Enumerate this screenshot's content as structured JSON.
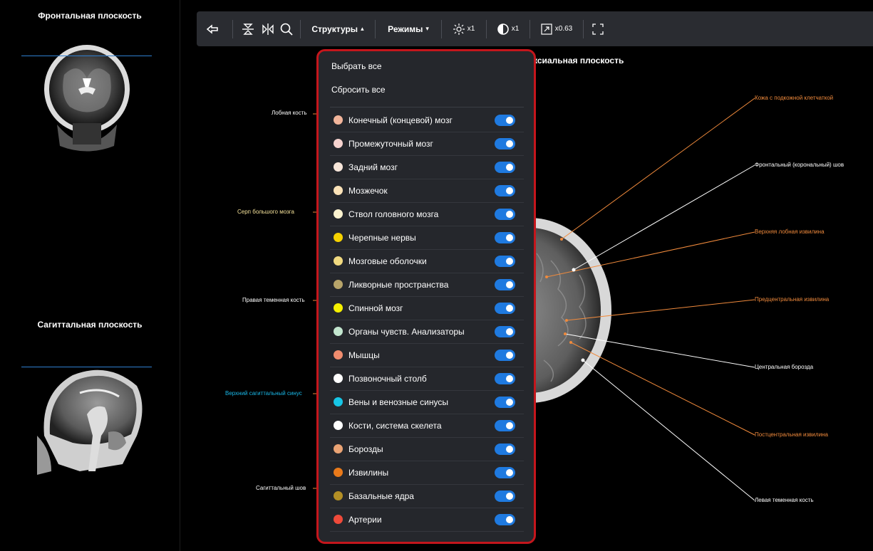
{
  "left_panel": {
    "frontal_title": "Фронтальная плоскость",
    "sagittal_title": "Сагиттальная плоскость"
  },
  "toolbar": {
    "structures_label": "Структуры",
    "modes_label": "Режимы",
    "brightness_value": "x1",
    "contrast_value": "x1",
    "zoom_value": "x0.63"
  },
  "viewer": {
    "axial_title": "ксиальная плоскость",
    "left_annotations": {
      "a1": "Лобная кость",
      "a2": "Серп большого мозга",
      "a3": "Правая теменная кость",
      "a4": "Верхний сагиттальный синус",
      "a5": "Сагиттальный шов"
    },
    "right_annotations": {
      "b1": "Кожа с подкожной клетчаткой",
      "b2": "Фронтальный (корональный) шов",
      "b3": "Верхняя лобная извилина",
      "b4": "Предцентральная извилина",
      "b5": "Центральная борозда",
      "b6": "Постцентральная извилина",
      "b7": "Левая теменная кость"
    }
  },
  "colors": {
    "accent_blue": "#1f7ae0",
    "highlight_red": "#c4161c",
    "annotation_orange": "#f08a3c",
    "annotation_yellow": "#f5e29a",
    "annotation_cyan": "#19b8e8"
  },
  "structures_menu": {
    "select_all": "Выбрать все",
    "reset_all": "Сбросить все",
    "items": [
      {
        "label": "Конечный (концевой) мозг",
        "color": "#f2b59b",
        "enabled": true
      },
      {
        "label": "Промежуточный мозг",
        "color": "#f6d3cf",
        "enabled": true
      },
      {
        "label": "Задний мозг",
        "color": "#f7e6da",
        "enabled": true
      },
      {
        "label": "Мозжечок",
        "color": "#fbe2b8",
        "enabled": true
      },
      {
        "label": "Ствол головного мозга",
        "color": "#fbf2cf",
        "enabled": true
      },
      {
        "label": "Черепные нервы",
        "color": "#f6d200",
        "enabled": true
      },
      {
        "label": "Мозговые оболочки",
        "color": "#f1da80",
        "enabled": true
      },
      {
        "label": "Ликворные пространства",
        "color": "#b7a46a",
        "enabled": true
      },
      {
        "label": "Спинной мозг",
        "color": "#f5f000",
        "enabled": true
      },
      {
        "label": "Органы чувств. Анализаторы",
        "color": "#c3e6cf",
        "enabled": true
      },
      {
        "label": "Мышцы",
        "color": "#f08c6e",
        "enabled": true
      },
      {
        "label": "Позвоночный столб",
        "color": "#ffffff",
        "enabled": true
      },
      {
        "label": "Вены и венозные синусы",
        "color": "#17c6e6",
        "enabled": true
      },
      {
        "label": "Кости, система скелета",
        "color": "#ffffff",
        "enabled": true
      },
      {
        "label": "Борозды",
        "color": "#eaa374",
        "enabled": true
      },
      {
        "label": "Извилины",
        "color": "#ea7a1a",
        "enabled": true
      },
      {
        "label": "Базальные ядра",
        "color": "#b38f25",
        "enabled": true
      },
      {
        "label": "Артерии",
        "color": "#ef4a3a",
        "enabled": true
      }
    ]
  }
}
